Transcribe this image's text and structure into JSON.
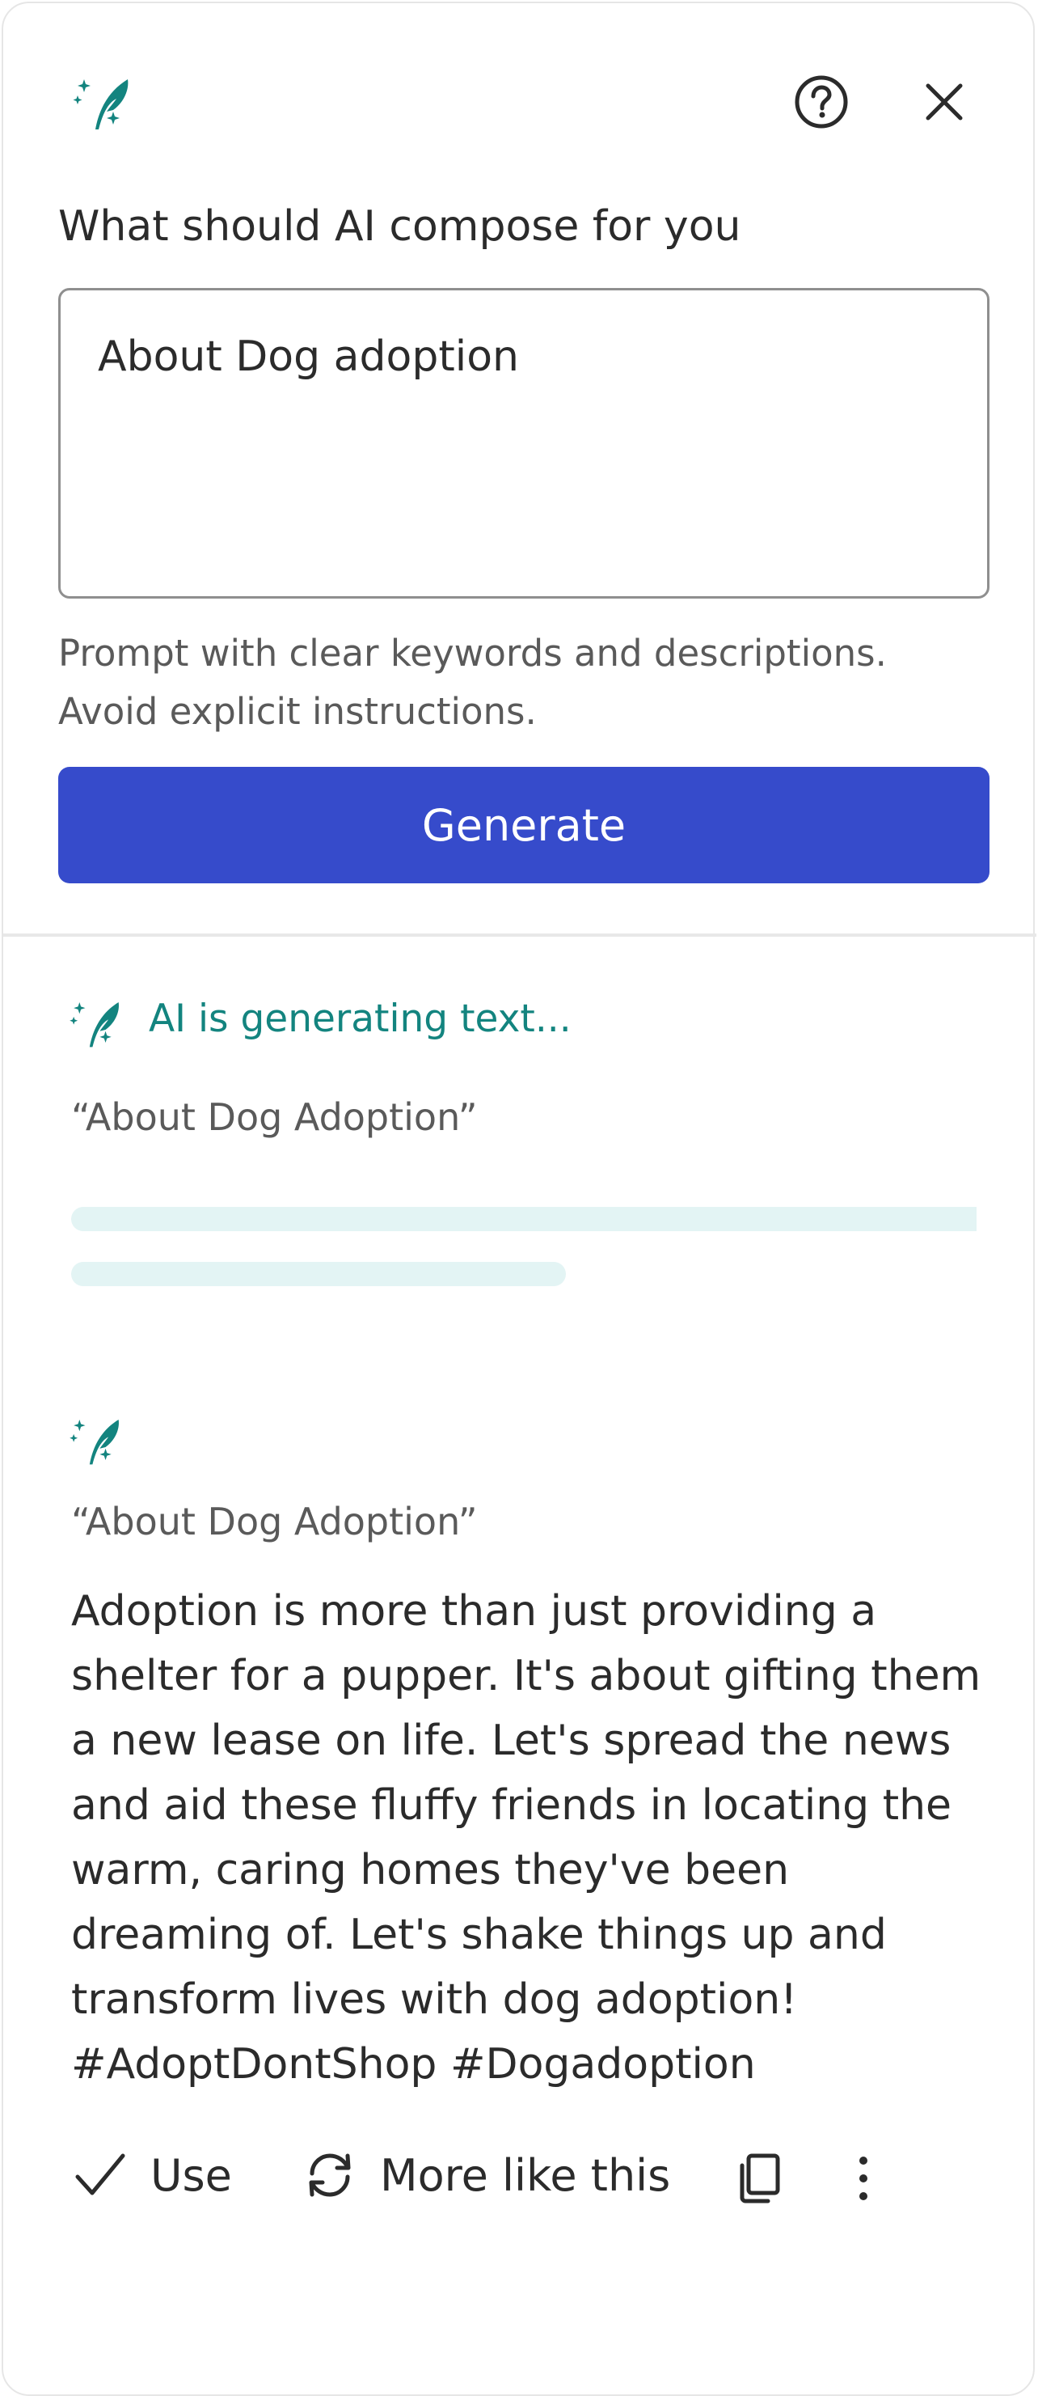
{
  "header": {
    "brand_icon": "sparkle-feather-icon",
    "help_icon": "help-circle-icon",
    "close_icon": "close-icon"
  },
  "prompt": {
    "label": "What should AI compose for you",
    "value": "About Dog adoption",
    "hint": "Prompt with clear keywords and descriptions. Avoid explicit instructions."
  },
  "generate": {
    "label": "Generate"
  },
  "generating": {
    "status": "AI is generating text...",
    "quote": "“About Dog Adoption”"
  },
  "result": {
    "quote": "“About Dog Adoption”",
    "text": "Adoption is more than just providing a shelter for a pupper. It's about gifting them a new lease on life. Let's spread the news and aid these fluffy friends in locating the warm, caring homes they've been dreaming of. Let's shake things up and transform lives with dog adoption! #AdoptDontShop #Dogadoption",
    "actions": {
      "use": "Use",
      "more": "More like this"
    }
  },
  "colors": {
    "accent": "#13847f",
    "primary_button": "#364bcb",
    "skeleton": "#e3f4f4"
  }
}
